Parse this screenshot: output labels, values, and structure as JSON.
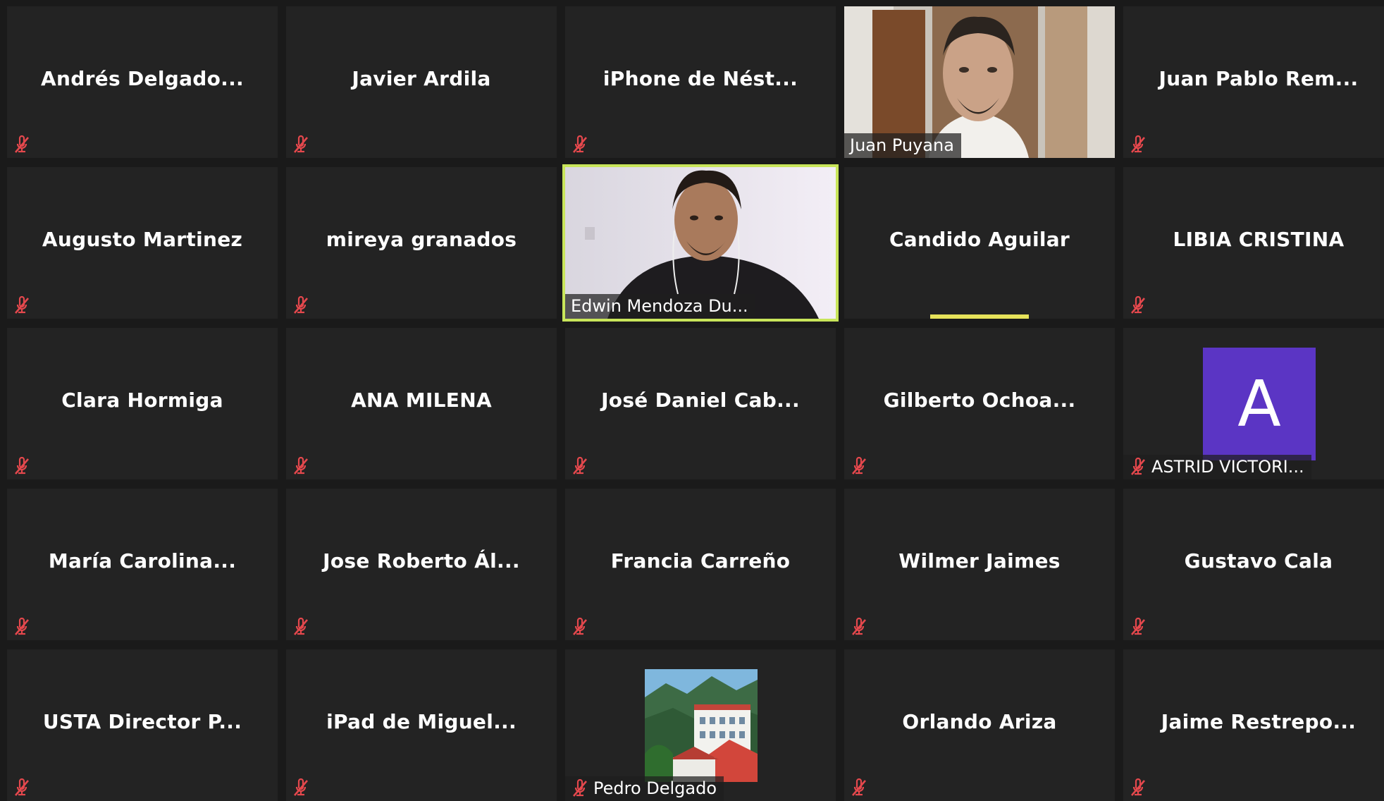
{
  "participants": [
    {
      "name": "Andrés  Delgado...",
      "muted": true
    },
    {
      "name": "Javier Ardila",
      "muted": true
    },
    {
      "name": "iPhone  de  Nést...",
      "muted": true
    },
    {
      "name": "Juan Puyana",
      "muted": false,
      "video": "man-office"
    },
    {
      "name": "Juan Pablo  Rem...",
      "muted": true
    },
    {
      "name": "Augusto Martinez",
      "muted": true
    },
    {
      "name": "mireya granados",
      "muted": true
    },
    {
      "name": "Edwin Mendoza Du...",
      "muted": false,
      "video": "man-headphones",
      "active_speaker": true
    },
    {
      "name": "Candido Aguilar",
      "muted": false,
      "speaking": true
    },
    {
      "name": "LIBIA CRISTINA",
      "muted": true
    },
    {
      "name": "Clara Hormiga",
      "muted": true
    },
    {
      "name": "ANA MILENA",
      "muted": true
    },
    {
      "name": "José  Daniel  Cab...",
      "muted": true
    },
    {
      "name": "Gilberto  Ochoa...",
      "muted": true
    },
    {
      "name": "ASTRID VICTORI...",
      "muted": true,
      "avatar_letter": "A"
    },
    {
      "name": "María  Carolina...",
      "muted": true
    },
    {
      "name": "Jose Roberto Ál...",
      "muted": true
    },
    {
      "name": "Francia Carreño",
      "muted": true
    },
    {
      "name": "Wilmer Jaimes",
      "muted": true
    },
    {
      "name": "Gustavo Cala",
      "muted": true
    },
    {
      "name": "USTA  Director  P...",
      "muted": true
    },
    {
      "name": "iPad  de  Miguel...",
      "muted": true
    },
    {
      "name": "Pedro Delgado",
      "muted": true,
      "profile_picture": "building-landscape"
    },
    {
      "name": "Orlando Ariza",
      "muted": true
    },
    {
      "name": "Jaime  Restrepo...",
      "muted": true
    }
  ],
  "colors": {
    "active_outline": "#c8e55a",
    "mute_icon": "#e5484d",
    "avatar_bg": "#5b35c4",
    "speaking_bar": "#e6e25a"
  }
}
